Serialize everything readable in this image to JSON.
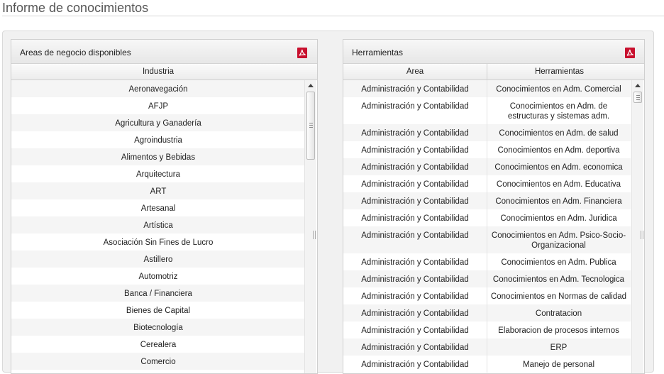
{
  "page": {
    "title": "Informe de conocimientos"
  },
  "left_panel": {
    "title": "Areas de negocio disponibles",
    "pdf_icon": "pdf-export-icon",
    "column": "Industria",
    "rows": [
      "Aeronavegación",
      "AFJP",
      "Agricultura y Ganadería",
      "Agroindustria",
      "Alimentos y Bebidas",
      "Arquitectura",
      "ART",
      "Artesanal",
      "Artística",
      "Asociación Sin Fines de Lucro",
      "Astillero",
      "Automotriz",
      "Banca / Financiera",
      "Bienes de Capital",
      "Biotecnología",
      "Cerealera",
      "Comercio"
    ]
  },
  "right_panel": {
    "title": "Herramientas",
    "pdf_icon": "pdf-export-icon",
    "columns": [
      "Area",
      "Herramientas"
    ],
    "rows": [
      [
        "Administración y Contabilidad",
        "Conocimientos en Adm. Comercial"
      ],
      [
        "Administración y Contabilidad",
        "Conocimientos en Adm. de estructuras y sistemas adm."
      ],
      [
        "Administración y Contabilidad",
        "Conocimientos en Adm. de salud"
      ],
      [
        "Administración y Contabilidad",
        "Conocimientos en Adm. deportiva"
      ],
      [
        "Administración y Contabilidad",
        "Conocimientos en Adm. economica"
      ],
      [
        "Administración y Contabilidad",
        "Conocimientos en Adm. Educativa"
      ],
      [
        "Administración y Contabilidad",
        "Conocimientos en Adm. Financiera"
      ],
      [
        "Administración y Contabilidad",
        "Conocimientos en Adm. Juridica"
      ],
      [
        "Administración y Contabilidad",
        "Conocimientos en Adm. Psico-Socio-Organizacional"
      ],
      [
        "Administración y Contabilidad",
        "Conocimientos en Adm. Publica"
      ],
      [
        "Administración y Contabilidad",
        "Conocimientos en Adm. Tecnologica"
      ],
      [
        "Administración y Contabilidad",
        "Conocimientos en Normas de calidad"
      ],
      [
        "Administración y Contabilidad",
        "Contratacion"
      ],
      [
        "Administración y Contabilidad",
        "Elaboracion de procesos internos"
      ],
      [
        "Administración y Contabilidad",
        "ERP"
      ],
      [
        "Administración y Contabilidad",
        "Manejo de personal"
      ]
    ]
  },
  "colors": {
    "pdf_icon": "#c8102e",
    "row_alt": "#f5f5f5"
  }
}
